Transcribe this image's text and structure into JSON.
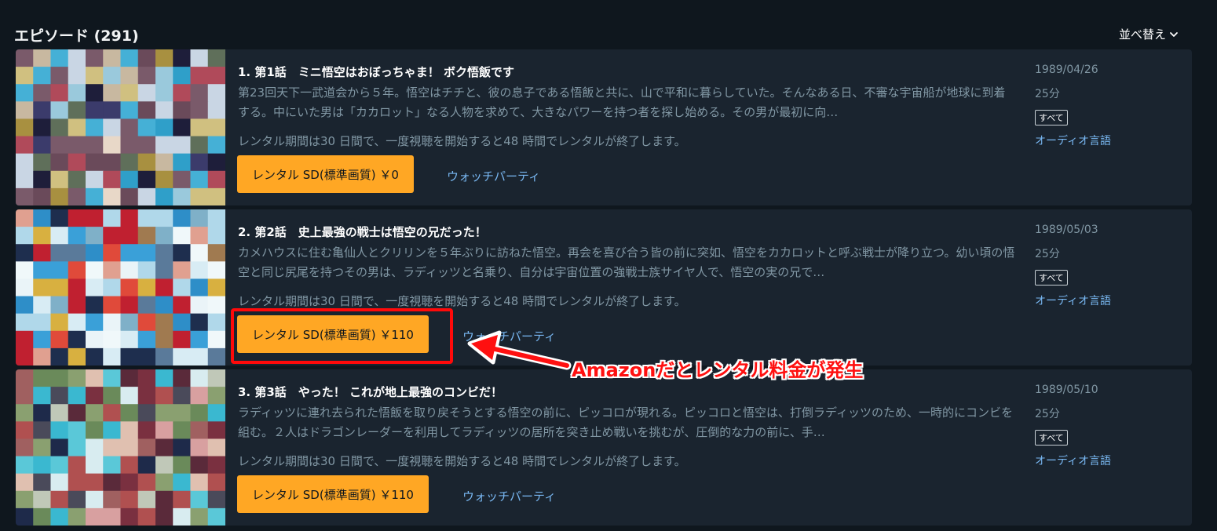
{
  "header": {
    "title": "エピソード (291)",
    "sort_label": "並べ替え"
  },
  "episodes": [
    {
      "title": "1. 第1話　ミニ悟空はおぼっちゃま！ ボク悟飯です",
      "synopsis": "第23回天下一武道会から５年。悟空はチチと、彼の息子である悟飯と共に、山で平和に暮らしていた。そんなある日、不審な宇宙船が地球に到着する。中にいた男は「カカロット」なる人物を求めて、大きなパワーを持つ者を探し始める。その男が最初に向…",
      "rental_note": "レンタル期間は30 日間で、一度視聴を開始すると48 時間でレンタルが終了します。",
      "rent_button_label": "レンタル SD(標準画質) ￥0",
      "watch_party_label": "ウォッチパーティ",
      "date": "1989/04/26",
      "duration": "25分",
      "rating": "すべて",
      "audio_label": "オーディオ言語"
    },
    {
      "title": "2. 第2話　史上最強の戦士は悟空の兄だった！",
      "synopsis": "カメハウスに住む亀仙人とクリリンを５年ぶりに訪ねた悟空。再会を喜び合う皆の前に突如、悟空をカカロットと呼ぶ戦士が降り立つ。幼い頃の悟空と同じ尻尾を持つその男は、ラディッツと名乗り、自分は宇宙位置の強戦士族サイヤ人で、悟空の実の兄で…",
      "rental_note": "レンタル期間は30 日間で、一度視聴を開始すると48 時間でレンタルが終了します。",
      "rent_button_label": "レンタル SD(標準画質) ￥110",
      "watch_party_label": "ウォッチパーティ",
      "date": "1989/05/03",
      "duration": "25分",
      "rating": "すべて",
      "audio_label": "オーディオ言語"
    },
    {
      "title": "3. 第3話　やった！ これが地上最強のコンビだ！",
      "synopsis": "ラディッツに連れ去られた悟飯を取り戻そうとする悟空の前に、ピッコロが現れる。ピッコロと悟空は、打倒ラディッツのため、一時的にコンビを組む。２人はドラゴンレーダーを利用してラディッツの居所を突き止め戦いを挑むが、圧倒的な力の前に、手…",
      "rental_note": "レンタル期間は30 日間で、一度視聴を開始すると48 時間でレンタルが終了します。",
      "rent_button_label": "レンタル SD(標準画質) ￥110",
      "watch_party_label": "ウォッチパーティ",
      "date": "1989/05/10",
      "duration": "25分",
      "rating": "すべて",
      "audio_label": "オーディオ言語"
    }
  ],
  "annotation": {
    "text": "Amazonだとレンタル料金が発生",
    "color": "#ff1010"
  },
  "colors": {
    "background": "#0f171e",
    "card": "#1a242f",
    "accent_button": "#ffa724",
    "link": "#79b8f3",
    "muted_text": "#8197a4"
  },
  "icons": {
    "sort": "chevron-down-icon",
    "thumbnail": "pixelated-episode-thumbnail"
  }
}
